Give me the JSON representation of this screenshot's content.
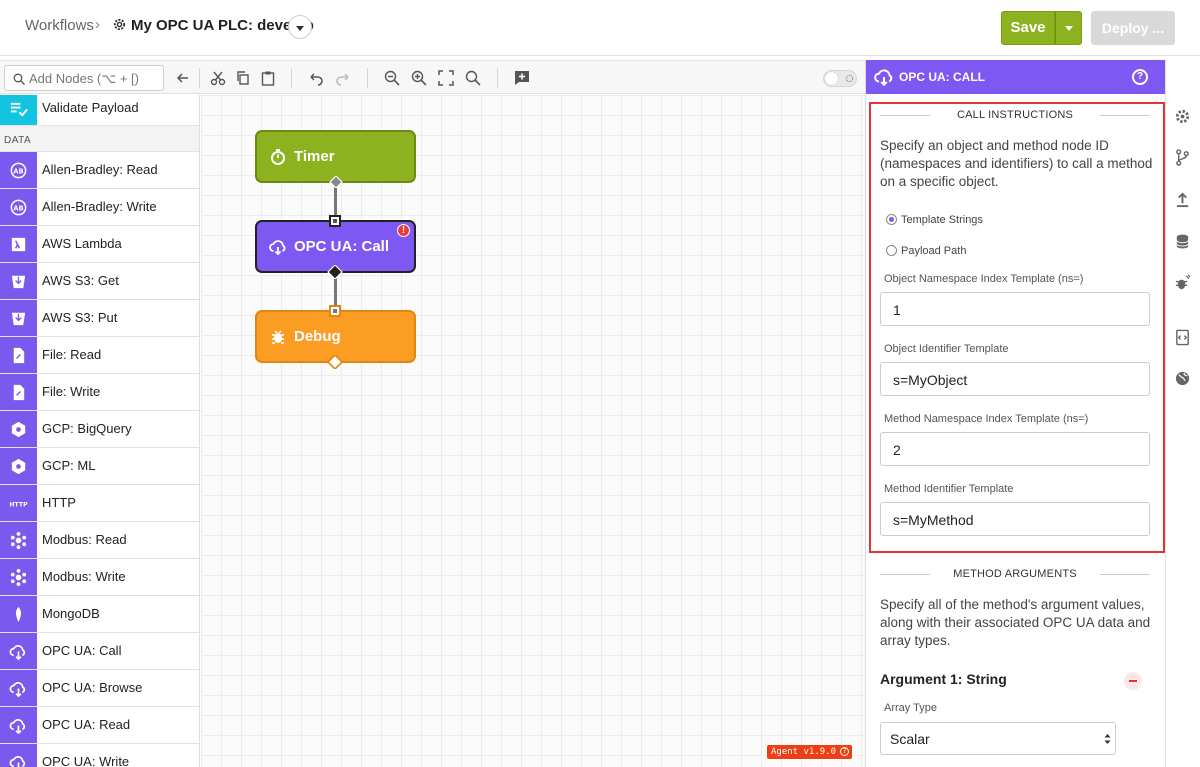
{
  "header": {
    "breadcrumb": "Workflows",
    "separator": "›",
    "workflow_name": "My OPC UA PLC: develop",
    "save_label": "Save",
    "deploy_label": "Deploy ..."
  },
  "toolbar": {
    "search_placeholder": "Add Nodes (⌥ + [)"
  },
  "sidebar": {
    "first_item": {
      "label": "Validate Payload",
      "icon": "validate-icon"
    },
    "section": "DATA",
    "items": [
      {
        "label": "Allen-Bradley: Read",
        "icon": "ab-icon"
      },
      {
        "label": "Allen-Bradley: Write",
        "icon": "ab-icon"
      },
      {
        "label": "AWS Lambda",
        "icon": "lambda-icon"
      },
      {
        "label": "AWS S3: Get",
        "icon": "bucket-icon"
      },
      {
        "label": "AWS S3: Put",
        "icon": "bucket-icon"
      },
      {
        "label": "File: Read",
        "icon": "file-icon"
      },
      {
        "label": "File: Write",
        "icon": "file-icon"
      },
      {
        "label": "GCP: BigQuery",
        "icon": "gcp-icon"
      },
      {
        "label": "GCP: ML",
        "icon": "gcp-icon"
      },
      {
        "label": "HTTP",
        "icon": "http-icon"
      },
      {
        "label": "Modbus: Read",
        "icon": "modbus-icon"
      },
      {
        "label": "Modbus: Write",
        "icon": "modbus-icon"
      },
      {
        "label": "MongoDB",
        "icon": "mongodb-icon"
      },
      {
        "label": "OPC UA: Call",
        "icon": "cloud-icon"
      },
      {
        "label": "OPC UA: Browse",
        "icon": "cloud-icon"
      },
      {
        "label": "OPC UA: Read",
        "icon": "cloud-icon"
      },
      {
        "label": "OPC UA: Write",
        "icon": "cloud-icon"
      }
    ]
  },
  "canvas": {
    "nodes": [
      {
        "label": "Timer",
        "color": "#8cb21f"
      },
      {
        "label": "OPC UA: Call",
        "color": "#7d58f2",
        "error": "!"
      },
      {
        "label": "Debug",
        "color": "#fb9c23"
      }
    ],
    "agent_version": "Agent v1.9.0"
  },
  "panel": {
    "title": "OPC UA: CALL",
    "call_section": "CALL INSTRUCTIONS",
    "call_desc": "Specify an object and method node ID (namespaces and identifiers) to call a method on a specific object.",
    "radio_template": "Template Strings",
    "radio_payload": "Payload Path",
    "fields": [
      {
        "label": "Object Namespace Index Template (ns=)",
        "value": "1"
      },
      {
        "label": "Object Identifier Template",
        "value": "s=MyObject"
      },
      {
        "label": "Method Namespace Index Template (ns=)",
        "value": "2"
      },
      {
        "label": "Method Identifier Template",
        "value": "s=MyMethod"
      }
    ],
    "args_section": "METHOD ARGUMENTS",
    "args_desc": "Specify all of the method's argument values, along with their associated OPC UA data and array types.",
    "arg1_title": "Argument 1: String",
    "array_type_label": "Array Type",
    "array_type_value": "Scalar"
  }
}
